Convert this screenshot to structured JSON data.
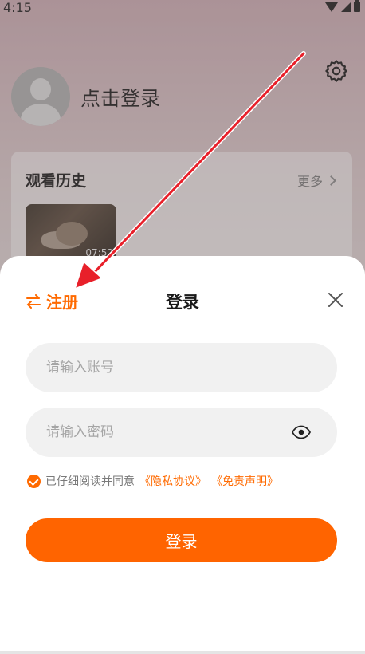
{
  "status_bar": {
    "time": "4:15",
    "icons": [
      "wifi-icon",
      "signal-icon",
      "battery-icon"
    ]
  },
  "profile": {
    "avatar_icon": "default-avatar-icon",
    "login_prompt": "点击登录",
    "settings_icon": "gear-icon"
  },
  "history": {
    "title": "观看历史",
    "more_label": "更多",
    "items": [
      {
        "duration": "07:52"
      }
    ]
  },
  "login_sheet": {
    "switch_label": "注册",
    "switch_icon": "swap-arrows-icon",
    "title": "登录",
    "close_icon": "close-icon",
    "account_placeholder": "请输入账号",
    "password_placeholder": "请输入密码",
    "password_toggle_icon": "eye-icon",
    "agreement": {
      "checked": true,
      "prefix": "已仔细阅读并同意",
      "privacy_link": "《隐私协议》",
      "disclaimer_link": "《免责声明》"
    },
    "login_button": "登录"
  },
  "colors": {
    "accent": "#ff6a00",
    "button": "#ff6400",
    "annotation_arrow": "#e8202a"
  }
}
